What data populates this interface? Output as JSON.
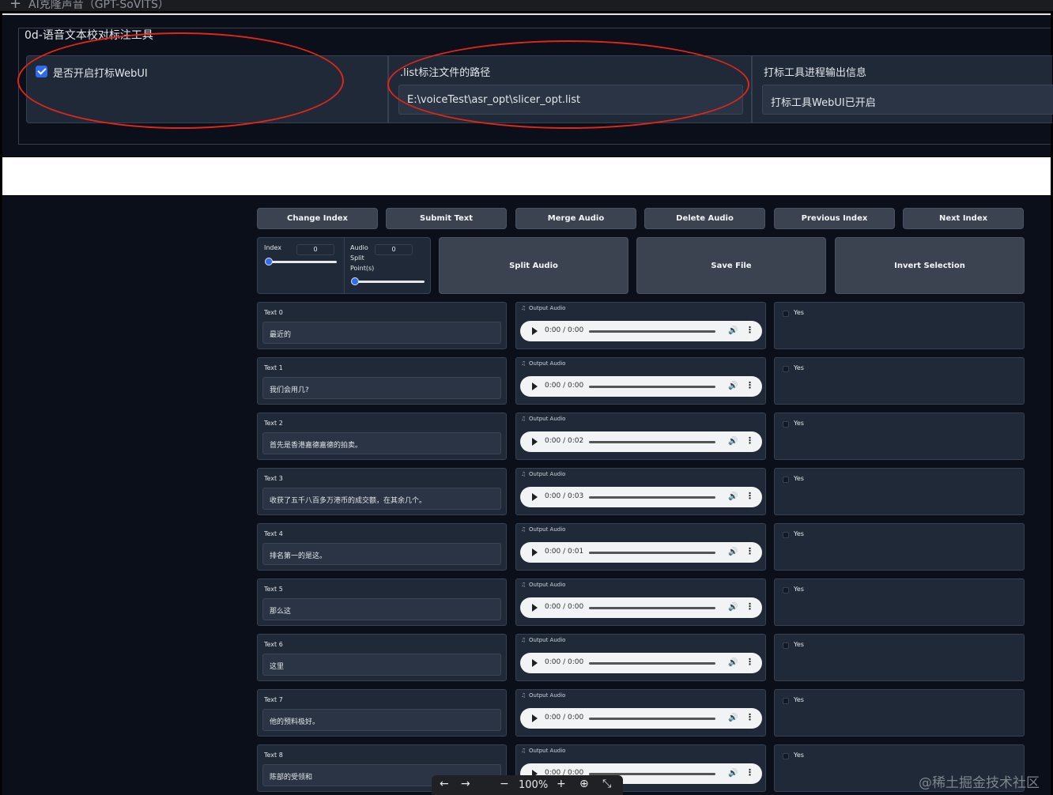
{
  "window": {
    "title": "AI克隆声音（GPT-SoVITS）"
  },
  "annotation_tool": {
    "title": "0d-语音文本校对标注工具",
    "enable_checkbox_label": "是否开启打标WebUI",
    "enable_checked": true,
    "list_path_label": ".list标注文件的路径",
    "list_path_value": "E:\\voiceTest\\asr_opt\\slicer_opt.list",
    "progress_label": "打标工具进程输出信息",
    "progress_value": "打标工具WebUI已开启"
  },
  "toolbar": {
    "change_index": "Change Index",
    "submit_text": "Submit Text",
    "merge_audio": "Merge Audio",
    "delete_audio": "Delete Audio",
    "previous_index": "Previous Index",
    "next_index": "Next Index"
  },
  "controls": {
    "index_label": "Index",
    "index_value": "0",
    "index_level": 0,
    "audio_split_label_1": "Audio",
    "audio_split_label_2": "Split",
    "audio_split_label_3": "Point(s)",
    "audio_split_value": "0",
    "audio_split_level": 0,
    "split_audio": "Split Audio",
    "save_file": "Save File",
    "invert_selection": "Invert Selection"
  },
  "output_audio_label": "Output Audio",
  "yes_label": "Yes",
  "rows": [
    {
      "label": "Text 0",
      "text": "最近的",
      "time": "0:00 / 0:00"
    },
    {
      "label": "Text 1",
      "text": "我们会用几?",
      "time": "0:00 / 0:00"
    },
    {
      "label": "Text 2",
      "text": "首先是香港嘉德嘉德的拍卖。",
      "time": "0:00 / 0:02"
    },
    {
      "label": "Text 3",
      "text": "收获了五千八百多万港币的成交额，在其余几个。",
      "time": "0:00 / 0:03"
    },
    {
      "label": "Text 4",
      "text": "排名第一的是这。",
      "time": "0:00 / 0:01"
    },
    {
      "label": "Text 5",
      "text": "那么这",
      "time": "0:00 / 0:00"
    },
    {
      "label": "Text 6",
      "text": "这里",
      "time": "0:00 / 0:00"
    },
    {
      "label": "Text 7",
      "text": "他的预料极好。",
      "time": "0:00 / 0:00"
    },
    {
      "label": "Text 8",
      "text": "陈部的受领和",
      "time": "0:00 / 0:00"
    }
  ],
  "viewer": {
    "zoom": "100%"
  },
  "watermark": "@稀土掘金技术社区"
}
